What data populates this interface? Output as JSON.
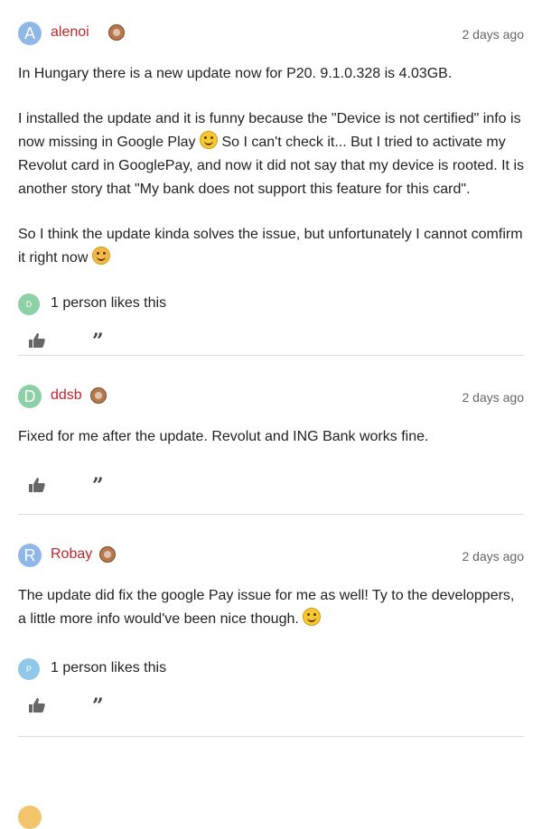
{
  "posts": [
    {
      "username": "alenoi",
      "avatar_letter": "A",
      "avatar_color": "#8fb7e8",
      "timestamp": "2 days ago",
      "paragraphs": [
        "In Hungary there is a new update now for P20. 9.1.0.328 is 4.03GB.",
        "I installed the update and it is funny because the \"Device is not certified\" info is now missing in Google Play",
        "So I can't check it... But I tried to activate my Revolut card in GooglePay, and now it did not say that my device is rooted. It is another story that \"My bank does not support this feature for this card\".",
        "So I think the update kinda solves the issue, but unfortunately I cannot comfirm it right now"
      ],
      "likes": {
        "avatar_letter": "D",
        "avatar_color": "#8ed0a6",
        "text": "1 person likes this"
      }
    },
    {
      "username": "ddsb",
      "avatar_letter": "D",
      "avatar_color": "#8ed0a6",
      "timestamp": "2 days ago",
      "paragraphs": [
        "Fixed for me after the update. Revolut and ING Bank works fine."
      ]
    },
    {
      "username": "Robay",
      "avatar_letter": "R",
      "avatar_color": "#8fb7e8",
      "timestamp": "2 days ago",
      "paragraphs": [
        "The update did fix the google Pay issue for me as well! Ty to the developpers, a little more info would've been nice though."
      ],
      "likes": {
        "avatar_letter": "P",
        "avatar_color": "#8fc8e8",
        "text": "1 person likes this"
      }
    }
  ],
  "icons": {
    "rank": "rank-badge-icon",
    "like": "thumbs-up-icon",
    "quote": "quote-icon",
    "emoji_grin": "grinning-emoji",
    "emoji_unamused": "unamused-emoji",
    "emoji_smile": "smiling-emoji"
  },
  "quote_glyph": "”"
}
